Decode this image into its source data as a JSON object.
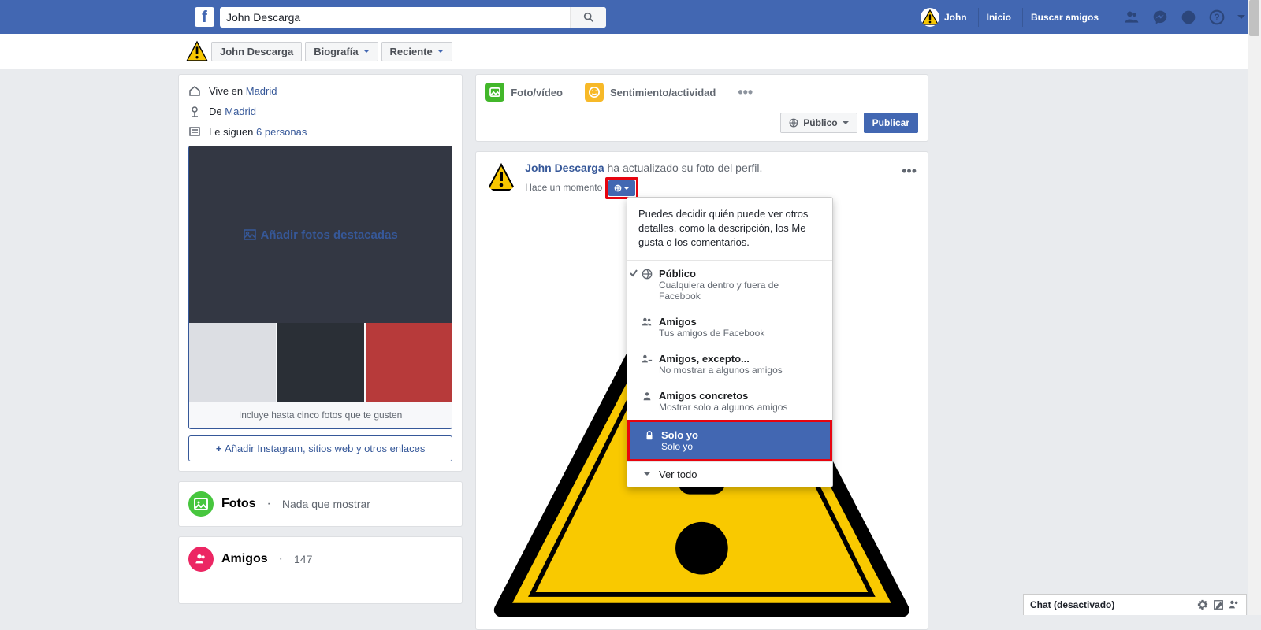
{
  "nav": {
    "search_value": "John Descarga",
    "username": "John",
    "home": "Inicio",
    "find_friends": "Buscar amigos"
  },
  "subheader": {
    "profile_name": "John Descarga",
    "tab1": "Biografía",
    "tab2": "Reciente"
  },
  "intro": {
    "lives_prefix": "Vive en ",
    "lives_link": "Madrid",
    "from_prefix": "De ",
    "from_link": "Madrid",
    "followed_prefix": "Le siguen ",
    "followed_link": "6 personas",
    "featured_add": "Añadir fotos destacadas",
    "featured_cap": "Incluye hasta cinco fotos que te gusten",
    "add_links": "Añadir Instagram, sitios web y otros enlaces"
  },
  "photos": {
    "title": "Fotos",
    "sub": "Nada que mostrar"
  },
  "friends": {
    "title": "Amigos",
    "count": "147"
  },
  "composer": {
    "photo": "Foto/vídeo",
    "feeling": "Sentimiento/actividad",
    "audience": "Público",
    "publish": "Publicar"
  },
  "story": {
    "name": "John Descarga",
    "action": " ha actualizado su foto del perfil.",
    "time": "Hace un momento"
  },
  "audience_menu": {
    "description": "Puedes decidir quién puede ver otros detalles, como la descripción, los Me gusta o los comentarios.",
    "opts": [
      {
        "title": "Público",
        "desc": "Cualquiera dentro y fuera de Facebook"
      },
      {
        "title": "Amigos",
        "desc": "Tus amigos de Facebook"
      },
      {
        "title": "Amigos, excepto...",
        "desc": "No mostrar a algunos amigos"
      },
      {
        "title": "Amigos concretos",
        "desc": "Mostrar solo a algunos amigos"
      },
      {
        "title": "Solo yo",
        "desc": "Solo yo"
      }
    ],
    "see_all": "Ver todo"
  },
  "chat": {
    "label": "Chat (desactivado)"
  }
}
